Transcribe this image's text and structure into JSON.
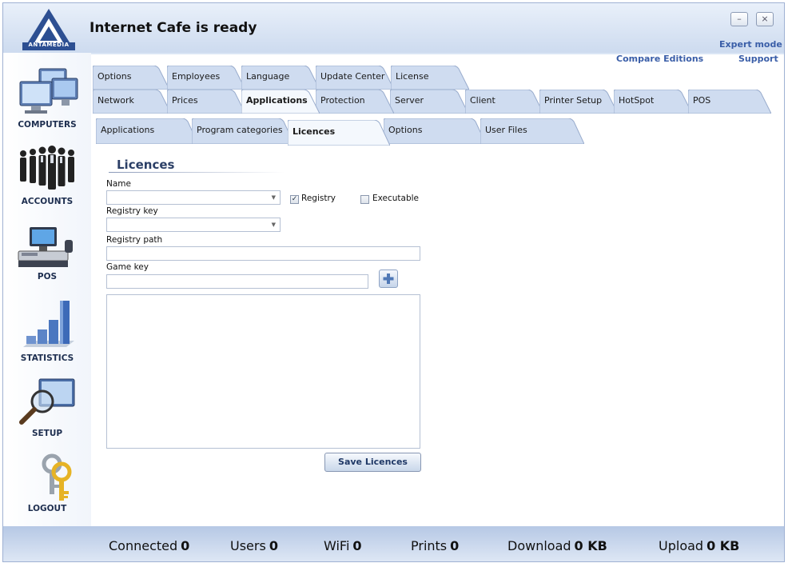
{
  "app": {
    "title": "Internet Cafe is ready",
    "logo_text": "ANTAMEDIA",
    "minimize_glyph": "–",
    "close_glyph": "⨯"
  },
  "links": {
    "expert_mode": "Expert mode",
    "compare_editions": "Compare Editions",
    "support": "Support"
  },
  "sidebar": {
    "items": [
      {
        "label": "COMPUTERS",
        "icon": "computers-icon"
      },
      {
        "label": "ACCOUNTS",
        "icon": "accounts-icon"
      },
      {
        "label": "POS",
        "icon": "pos-icon"
      },
      {
        "label": "STATISTICS",
        "icon": "statistics-icon"
      },
      {
        "label": "SETUP",
        "icon": "setup-icon"
      },
      {
        "label": "LOGOUT",
        "icon": "keys-icon"
      }
    ]
  },
  "tabs": {
    "row1": [
      "Options",
      "Employees",
      "Language",
      "Update Center",
      "License"
    ],
    "row2": [
      "Network",
      "Prices",
      "Applications",
      "Protection",
      "Server",
      "Client",
      "Printer Setup",
      "HotSpot",
      "POS"
    ],
    "active_row2": "Applications"
  },
  "subtabs": {
    "items": [
      "Applications",
      "Program categories",
      "Licences",
      "Options",
      "User Files"
    ],
    "active": "Licences"
  },
  "form": {
    "section_title": "Licences",
    "name_label": "Name",
    "name_value": "",
    "registry_label": "Registry",
    "registry_checked": true,
    "executable_label": "Executable",
    "executable_checked": false,
    "registry_key_label": "Registry key",
    "registry_key_value": "",
    "registry_path_label": "Registry path",
    "registry_path_value": "",
    "game_key_label": "Game key",
    "game_key_value": "",
    "check_glyph": "✓",
    "combo_arrow": "▼",
    "save_label": "Save Licences"
  },
  "status": {
    "connected_label": "Connected",
    "connected_value": "0",
    "users_label": "Users",
    "users_value": "0",
    "wifi_label": "WiFi",
    "wifi_value": "0",
    "prints_label": "Prints",
    "prints_value": "0",
    "download_label": "Download",
    "download_value": "0 KB",
    "upload_label": "Upload",
    "upload_value": "0 KB"
  },
  "colors": {
    "accent": "#3a5ea8",
    "tab_fill": "#cfdcf0",
    "window_frame": "#9fb1d3"
  }
}
